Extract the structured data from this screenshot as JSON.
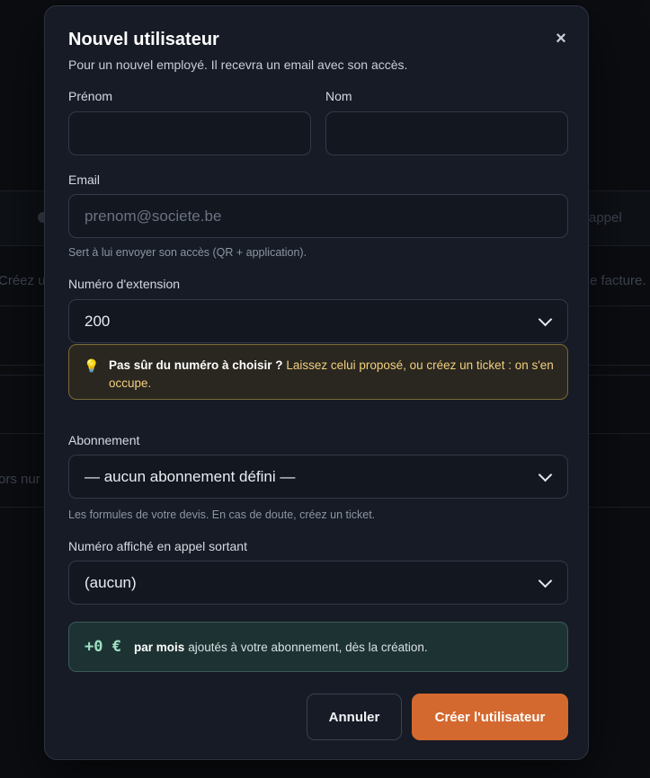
{
  "background": {
    "left_text_row1": "Créez u",
    "right_text_row1": "e facture.",
    "left_text_row2": "ors nur",
    "header_right": "appel"
  },
  "modal": {
    "title": "Nouvel utilisateur",
    "subtitle": "Pour un nouvel employé. Il recevra un email avec son accès.",
    "close_label": "×",
    "firstname": {
      "label": "Prénom",
      "value": "",
      "placeholder": ""
    },
    "lastname": {
      "label": "Nom",
      "value": "",
      "placeholder": ""
    },
    "email": {
      "label": "Email",
      "placeholder": "prenom@societe.be",
      "hint": "Sert à lui envoyer son accès (QR + application)."
    },
    "extension": {
      "label": "Numéro d'extension",
      "value": "200"
    },
    "tip": {
      "icon": "lightbulb-icon",
      "icon_glyph": "💡",
      "bold": "Pas sûr du numéro à choisir ?",
      "text": " Laissez celui proposé, ou créez un ticket : on s'en occupe."
    },
    "subscription": {
      "label": "Abonnement",
      "value": "— aucun abonnement défini —",
      "hint": "Les formules de votre devis. En cas de doute, créez un ticket."
    },
    "caller_id": {
      "label": "Numéro affiché en appel sortant",
      "value": "(aucun)"
    },
    "price": {
      "amount": "+0 €",
      "bold": "par mois",
      "text": "ajoutés à votre abonnement, dès la création."
    },
    "buttons": {
      "cancel": "Annuler",
      "create": "Créer l'utilisateur"
    }
  },
  "colors": {
    "accent": "#d4692f",
    "modal_bg": "#161b25",
    "tip_border": "#7a6a36",
    "price_bg": "#1d3233"
  }
}
